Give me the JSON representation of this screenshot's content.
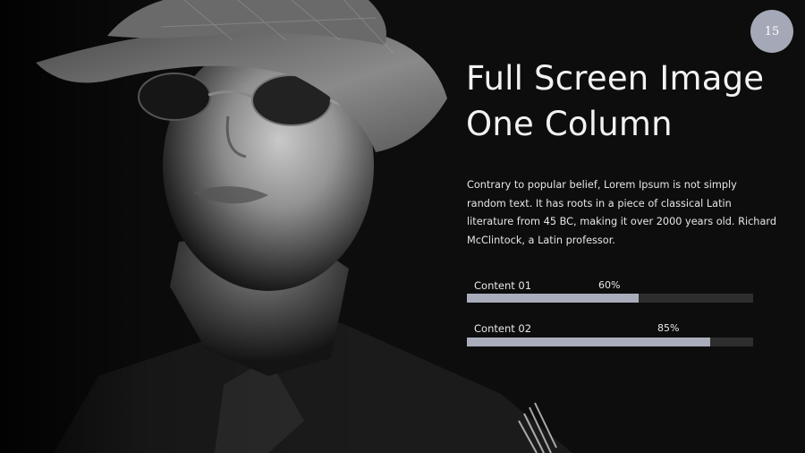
{
  "slide": {
    "page_number": "15",
    "title_lines": [
      "Full Screen Image",
      "One Column"
    ],
    "body": "Contrary to popular belief, Lorem Ipsum is not simply random text. It has roots in a piece of classical Latin literature from 45 BC, making it over 2000 years old. Richard McClintock, a Latin professor."
  },
  "progress": [
    {
      "label": "Content 01",
      "percent_label": "60%",
      "value": 0.6
    },
    {
      "label": "Content 02",
      "percent_label": "85%",
      "value": 0.85
    }
  ],
  "colors": {
    "background": "#0d0d0d",
    "accent": "#a5a8b6",
    "bar_fill": "#a9adbb",
    "bar_track": "#2e2e2e",
    "text": "#f2f2f2"
  }
}
